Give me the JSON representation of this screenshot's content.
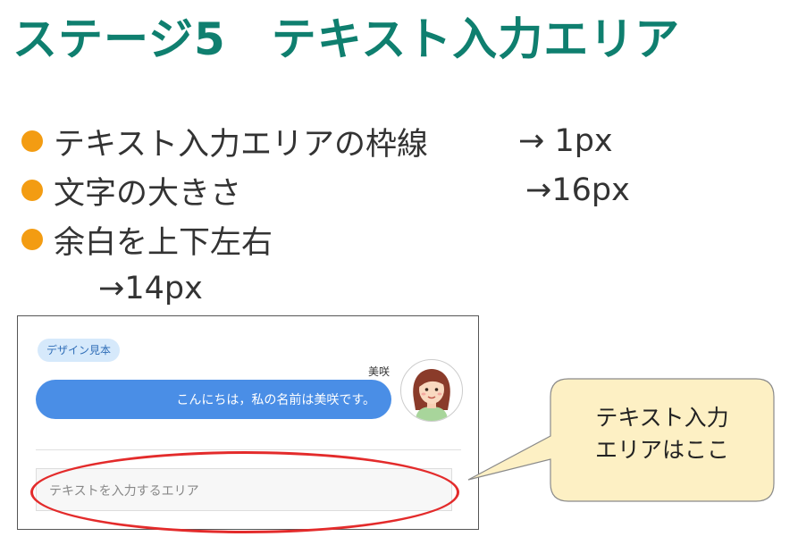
{
  "title": "ステージ5　テキスト入力エリア",
  "bullets": [
    {
      "label": "テキスト入力エリアの枠線",
      "value": "→  1px"
    },
    {
      "label": "文字の大きさ",
      "value": "→16px"
    },
    {
      "label": "余白を上下左右",
      "value": "→14px"
    }
  ],
  "mockup": {
    "badge": "デザイン見本",
    "speaker_name": "美咲",
    "message": "こんにちは，私の名前は美咲です。",
    "textarea_placeholder": "テキストを入力するエリア"
  },
  "callout": {
    "line1": "テキスト入力",
    "line2": "エリアはここ"
  },
  "colors": {
    "title": "#0f7f6f",
    "bullet_dot": "#f39c12",
    "chat_bubble": "#4a8ee6",
    "badge_bg": "#d6e9fb",
    "highlight_ellipse": "#e32b2b",
    "callout_bg": "#fdf0c4"
  },
  "icons": {
    "avatar": "girl-avatar-icon",
    "bullet": "orange-dot-icon"
  }
}
